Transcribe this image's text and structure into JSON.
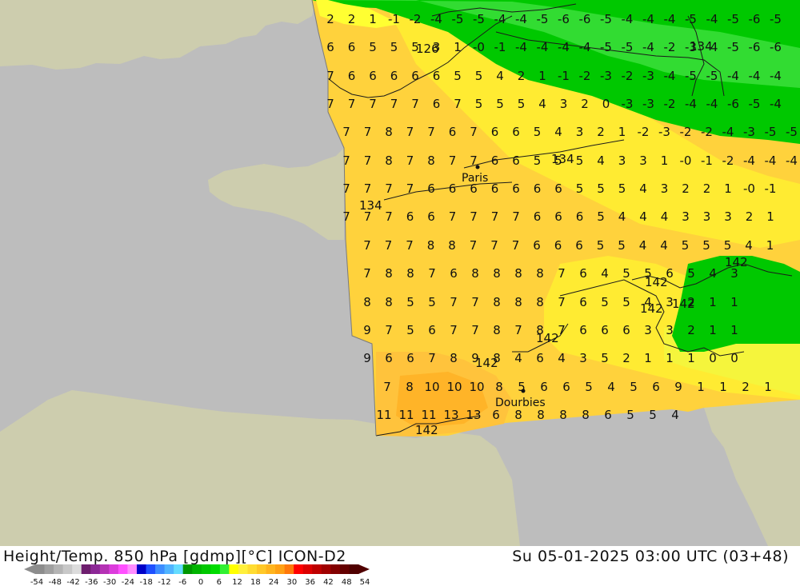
{
  "header": {
    "title": "Height/Temp. 850 hPa [gdmp][°C] ICON-D2",
    "valid_time": "Su 05-01-2025 03:00 UTC (03+48)"
  },
  "cities": [
    {
      "name": "Paris"
    },
    {
      "name": "Dourbies"
    }
  ],
  "legend": {
    "ticks": [
      "-54",
      "-48",
      "-42",
      "-36",
      "-30",
      "-24",
      "-18",
      "-12",
      "-6",
      "0",
      "6",
      "12",
      "18",
      "24",
      "30",
      "36",
      "42",
      "48",
      "54"
    ],
    "colors": [
      "#8c8c8c",
      "#a0a0a0",
      "#b4b4b4",
      "#c8c8c8",
      "#dcdcdc",
      "#6e1e6e",
      "#8c2896",
      "#b432b4",
      "#dc3cdc",
      "#ff50ff",
      "#ff8cff",
      "#0000c8",
      "#1e50ff",
      "#3c8cff",
      "#50b4ff",
      "#64dcff",
      "#009600",
      "#00b400",
      "#00c800",
      "#00dc00",
      "#32f032",
      "#ffff00",
      "#fff03c",
      "#ffdc32",
      "#ffc828",
      "#ffb41e",
      "#ffa014",
      "#ff780a",
      "#ff0000",
      "#dc0000",
      "#be0000",
      "#a00000",
      "#820000",
      "#640000",
      "#500000"
    ]
  },
  "contours": [
    "126",
    "134",
    "134",
    "134",
    "142",
    "142",
    "142",
    "142",
    "142",
    "142",
    "142"
  ],
  "grid_values": [
    [
      "2",
      "2",
      "1",
      "-1",
      "-2",
      "-4",
      "-5",
      "-5",
      "-4",
      "-4",
      "-5",
      "-6",
      "-6",
      "-5",
      "-4",
      "-4",
      "-4",
      "-5",
      "-4",
      "-5",
      "-6",
      "-5",
      "-6"
    ],
    [
      "6",
      "6",
      "5",
      "5",
      "5",
      "3",
      "1",
      "-0",
      "-1",
      "-4",
      "-4",
      "-4",
      "-4",
      "-5",
      "-5",
      "-4",
      "-2",
      "-3",
      "-4",
      "-5",
      "-6",
      "-6",
      "-6"
    ],
    [
      "7",
      "6",
      "6",
      "6",
      "6",
      "6",
      "5",
      "5",
      "4",
      "2",
      "1",
      "-1",
      "-2",
      "-3",
      "-2",
      "-3",
      "-4",
      "-5",
      "-5",
      "-4",
      "-4",
      "-4",
      "-6"
    ],
    [
      "7",
      "7",
      "7",
      "7",
      "7",
      "6",
      "7",
      "5",
      "5",
      "5",
      "4",
      "3",
      "2",
      "0",
      "-3",
      "-3",
      "-2",
      "-4",
      "-4",
      "-6",
      "-5",
      "-4",
      "-5"
    ],
    [
      "7",
      "7",
      "8",
      "7",
      "7",
      "6",
      "7",
      "6",
      "6",
      "5",
      "4",
      "3",
      "2",
      "1",
      "-2",
      "-3",
      "-2",
      "-2",
      "-4",
      "-3",
      "-5",
      "-5"
    ],
    [
      "7",
      "7",
      "8",
      "7",
      "8",
      "7",
      "7",
      "6",
      "6",
      "5",
      "5",
      "5",
      "4",
      "3",
      "3",
      "1",
      "-0",
      "-1",
      "-2",
      "-4",
      "-4",
      "-4"
    ],
    [
      "7",
      "7",
      "7",
      "7",
      "6",
      "6",
      "6",
      "6",
      "6",
      "6",
      "6",
      "5",
      "5",
      "5",
      "4",
      "3",
      "2",
      "2",
      "1",
      "-0",
      "-1"
    ],
    [
      "7",
      "7",
      "7",
      "6",
      "6",
      "7",
      "7",
      "7",
      "7",
      "6",
      "6",
      "6",
      "5",
      "4",
      "4",
      "4",
      "3",
      "3",
      "3",
      "2",
      "1"
    ],
    [
      "7",
      "7",
      "7",
      "8",
      "8",
      "7",
      "7",
      "7",
      "6",
      "6",
      "6",
      "5",
      "5",
      "4",
      "4",
      "5",
      "5",
      "5",
      "4",
      "1"
    ],
    [
      "7",
      "8",
      "8",
      "7",
      "6",
      "8",
      "8",
      "8",
      "8",
      "7",
      "6",
      "4",
      "5",
      "5",
      "6",
      "5",
      "4",
      "3"
    ],
    [
      "8",
      "8",
      "5",
      "5",
      "7",
      "7",
      "8",
      "8",
      "8",
      "7",
      "6",
      "5",
      "5",
      "4",
      "3",
      "2",
      "1",
      "1"
    ],
    [
      "9",
      "7",
      "5",
      "6",
      "7",
      "7",
      "8",
      "7",
      "8",
      "7",
      "6",
      "6",
      "6",
      "3",
      "3",
      "2",
      "1",
      "1"
    ],
    [
      "9",
      "6",
      "6",
      "7",
      "8",
      "9",
      "8",
      "4",
      "6",
      "4",
      "3",
      "5",
      "2",
      "1",
      "1",
      "1",
      "0",
      "0"
    ],
    [
      "7",
      "8",
      "10",
      "10",
      "10",
      "8",
      "5",
      "6",
      "6",
      "5",
      "4",
      "5",
      "6",
      "9",
      "1",
      "1",
      "2",
      "1"
    ],
    [
      "11",
      "11",
      "11",
      "13",
      "13",
      "6",
      "8",
      "8",
      "8",
      "8",
      "6",
      "5",
      "5",
      "4"
    ]
  ]
}
